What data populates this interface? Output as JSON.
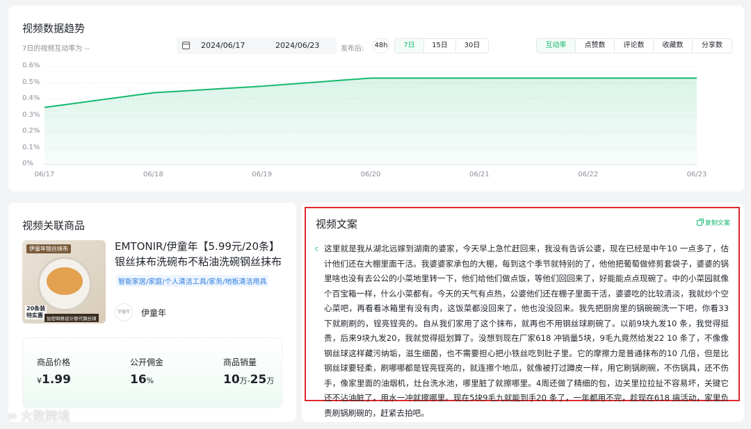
{
  "trend": {
    "title": "视频数据趋势",
    "subtitle": "7日的视频互动率为 --",
    "date_start": "2024/06/17",
    "date_end": "2024/06/23",
    "publish_label": "发布后:",
    "range_48h": "48h",
    "ranges": [
      "7日",
      "15日",
      "30日"
    ],
    "active_range": "7日",
    "metrics": [
      "互动率",
      "点赞数",
      "评论数",
      "收藏数",
      "分享数"
    ],
    "active_metric": "互动率",
    "accent_color": "#14b86e"
  },
  "chart_data": {
    "type": "area",
    "title": "",
    "xlabel": "",
    "ylabel": "",
    "x": [
      "06/17",
      "06/18",
      "06/19",
      "06/20",
      "06/21",
      "06/22",
      "06/23"
    ],
    "y_ticks": [
      "0%",
      "0.1%",
      "0.2%",
      "0.3%",
      "0.4%",
      "0.5%",
      "0.6%"
    ],
    "ylim": [
      0,
      0.6
    ],
    "series": [
      {
        "values": [
          0.35,
          0.44,
          0.48,
          0.53,
          0.53,
          0.53,
          0.53
        ]
      }
    ],
    "grid": true
  },
  "product": {
    "title": "视频关联商品",
    "name": "EMTONIR/伊童年【5.99元/20条】银丝抹布洗碗布不粘油洗碗钢丝抹布",
    "category_tags": "智能家居/家庭/个人清洁工具/家务/地板清洁用具",
    "brand_avatar_text": "伊童年",
    "brand": "伊童年",
    "thumb_banner": "伊童年银丝抹布",
    "thumb_badge_1": "20条装",
    "thumb_badge_2": "特实惠",
    "thumb_caption": "加密网格设计替代钢丝球",
    "stats": {
      "price_label": "商品价格",
      "price_currency": "¥",
      "price_value": "1.99",
      "commission_label": "公开佣金",
      "commission_value": "16",
      "commission_unit": "%",
      "sales_label": "商品销量",
      "sales_from": "10",
      "sales_unit1": "万-",
      "sales_to": "25",
      "sales_unit2": "万"
    }
  },
  "script": {
    "title": "视频文案",
    "copy_label": "复制文案",
    "marker": "c",
    "text": "这里就是我从湖北远嫁到湖南的婆家，今天早上急忙赶回来，我没有告诉公婆，现在已经是中午10 一点多了，估计他们还在大棚里面干活。我婆婆家承包的大棚，每到这个季节就特别的了，他他把葡萄做修剪套袋子，婆婆的锅里啥也没有去公公的小菜地里转一下，他们给他们做点饭，等他们回回来了，好能能点点现碗了。中的小菜园就像个百宝箱一样，什么小菜都有。今天的天气有点热，公婆他们还在棚子里面干活，婆婆吃的比较清淡，我就炒个空心菜吧，再看看冰箱里有没有肉，这饭菜都没回来了，他也没没回来。我先把厨房里的锅碗碗洗一下吧，你看33 下就刷刷的，锃亮锃亮的。自从我们家用了这个抹布，就再也不用钢丝球刷碗了。以前9块九发10 条，我觉得挺贵，后来9块九发20，我就觉得挺划算了。没想到现在厂家618 冲销量5块，9毛九竟然给发22 10 条了，不像像钢丝球这样藏污纳垢，滋生细菌，也不需要担心把小铁丝吃到肚子里。它的摩擦力是普通抹布的10 几倍，但是比钢丝球要轻柔，刷哪哪都是锃亮锃亮的，就连擦个地瓜，就像被打过蹲皮一样，用它刷锅刷碗，不伤锅具，还不伤手，像家里面的油烟机，灶台洗水池，哪里脏了就擦哪里。4周还做了精细的包，边关里拉拉扯不容易坏，关键它还不沾油脏了，用水一冲就擦哪里。现在5块9毛九就能到手20 条了，一年都用不完，趁现在618 搞活动，家里负责刷锅刷碗的，赶紧去拍吧。"
  },
  "watermark": "大数跨境"
}
